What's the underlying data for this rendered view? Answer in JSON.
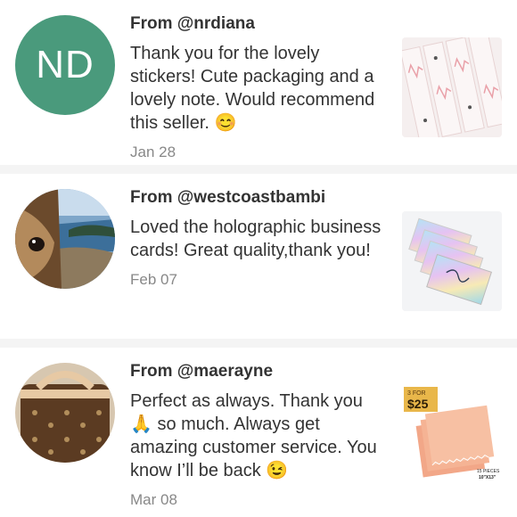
{
  "reviews": [
    {
      "avatar_initials": "ND",
      "from": "From @nrdiana",
      "text": "Thank you for the lovely stickers! Cute packaging and a lovely note. Would recommend this seller.",
      "emoji": "😊",
      "date": "Jan 28"
    },
    {
      "from": "From @westcoastbambi",
      "text": "Loved the holographic business cards! Great quality,thank you!",
      "date": "Feb 07"
    },
    {
      "from": "From @maerayne",
      "text_before": "Perfect as always. Thank you",
      "emoji_mid": "🙏",
      "text_after": "so much. Always get amazing customer service. You know I’ll be back",
      "emoji": "😉",
      "date": "Mar 08",
      "thumb_price_top": "3 FOR",
      "thumb_price": "$25",
      "thumb_caption_1": "15 PIECES",
      "thumb_caption_2": "10\"X13\""
    }
  ]
}
